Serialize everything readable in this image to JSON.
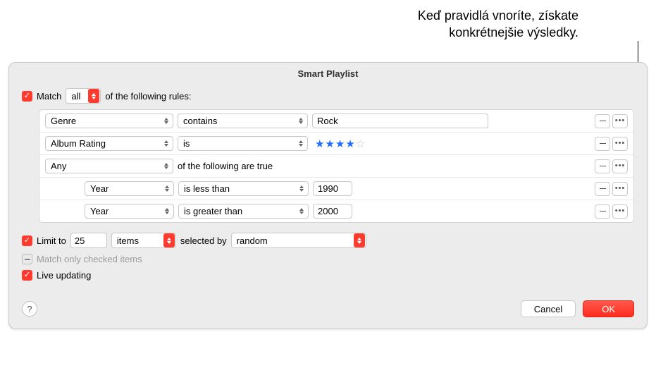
{
  "annotation": {
    "line1": "Keď pravidlá vnoríte, získate",
    "line2": "konkrétnejšie výsledky."
  },
  "window": {
    "title": "Smart Playlist"
  },
  "match": {
    "checkbox_checked": true,
    "label_before": "Match",
    "mode": "all",
    "label_after": "of the following rules:"
  },
  "rules": [
    {
      "indent": 1,
      "field": "Genre",
      "op": "contains",
      "value_type": "text",
      "value": "Rock",
      "field_w": 182,
      "op_w": 185
    },
    {
      "indent": 1,
      "field": "Album Rating",
      "op": "is",
      "value_type": "stars",
      "stars_filled": 4,
      "stars_total": 5,
      "field_w": 182,
      "op_w": 185
    },
    {
      "indent": 1,
      "field": "Any",
      "after_text": "of the following are true",
      "value_type": "group",
      "field_w": 182
    },
    {
      "indent": 2,
      "field": "Year",
      "op": "is less than",
      "value_type": "num",
      "value": "1990",
      "field_w": 127,
      "op_w": 185
    },
    {
      "indent": 2,
      "field": "Year",
      "op": "is greater than",
      "value_type": "num",
      "value": "2000",
      "field_w": 127,
      "op_w": 185
    }
  ],
  "limit": {
    "checked": true,
    "label": "Limit to",
    "count": "25",
    "unit": "items",
    "selected_by_label": "selected by",
    "method": "random"
  },
  "match_only": {
    "label": "Match only checked items"
  },
  "live": {
    "checked": true,
    "label": "Live updating"
  },
  "footer": {
    "help": "?",
    "cancel": "Cancel",
    "ok": "OK"
  },
  "icons": {
    "check": "✓"
  }
}
